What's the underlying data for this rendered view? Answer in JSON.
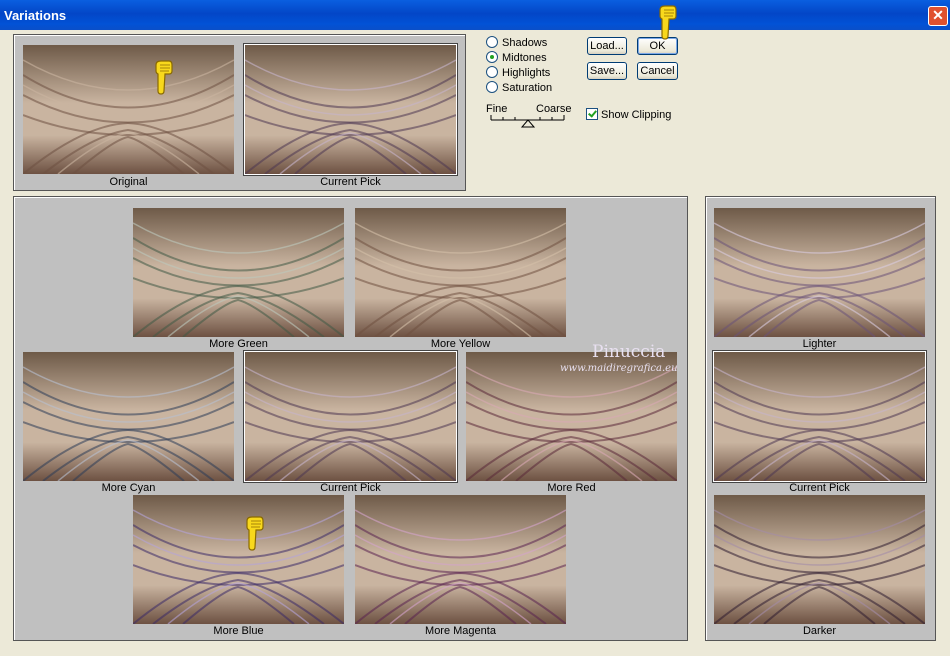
{
  "window": {
    "title": "Variations",
    "close_glyph": "✕"
  },
  "top_thumbs": [
    {
      "label": "Original",
      "tint": "orig"
    },
    {
      "label": "Current Pick",
      "tint": "current"
    }
  ],
  "options": {
    "radios": [
      {
        "label": "Shadows",
        "selected": false
      },
      {
        "label": "Midtones",
        "selected": true
      },
      {
        "label": "Highlights",
        "selected": false
      },
      {
        "label": "Saturation",
        "selected": false
      }
    ],
    "slider": {
      "fine_label": "Fine",
      "coarse_label": "Coarse"
    },
    "buttons": {
      "load": "Load...",
      "ok": "OK",
      "save": "Save...",
      "cancel": "Cancel"
    },
    "show_clipping": {
      "label": "Show Clipping",
      "checked": true
    }
  },
  "color_grid": [
    {
      "label": "More Green",
      "tint": "green"
    },
    {
      "label": "More Yellow",
      "tint": "yellow"
    },
    {
      "label": "More Cyan",
      "tint": "cyan"
    },
    {
      "label": "Current Pick",
      "tint": "current"
    },
    {
      "label": "More Red",
      "tint": "red"
    },
    {
      "label": "More Blue",
      "tint": "blue"
    },
    {
      "label": "More Magenta",
      "tint": "magenta"
    }
  ],
  "brightness": [
    {
      "label": "Lighter",
      "tint": "lighter"
    },
    {
      "label": "Current Pick",
      "tint": "current"
    },
    {
      "label": "Darker",
      "tint": "darker"
    }
  ],
  "watermark": {
    "name": "Pinuccia",
    "url": "www.maidiregrafica.eu"
  },
  "tints": {
    "orig": {
      "top": "#6e5a48",
      "mid": "#c9b4a0",
      "bot": "#6d5142"
    },
    "current": {
      "top": "#5a4862",
      "mid": "#c6b4cc",
      "bot": "#4c3652"
    },
    "green": {
      "top": "#4e6654",
      "mid": "#bcc8bc",
      "bot": "#3f5a46"
    },
    "yellow": {
      "top": "#7a6050",
      "mid": "#d4c0a8",
      "bot": "#705040"
    },
    "cyan": {
      "top": "#3c5270",
      "mid": "#b8c0d0",
      "bot": "#2c3c58"
    },
    "red": {
      "top": "#6a3e52",
      "mid": "#d8a8b4",
      "bot": "#5a2838"
    },
    "blue": {
      "top": "#4a3a7c",
      "mid": "#b4a4d8",
      "bot": "#3a2a68"
    },
    "magenta": {
      "top": "#6a3a6c",
      "mid": "#d4a4cc",
      "bot": "#5a2250"
    },
    "lighter": {
      "top": "#76648a",
      "mid": "#d8cce0",
      "bot": "#6a5278"
    },
    "darker": {
      "top": "#3c2c44",
      "mid": "#a48ca8",
      "bot": "#2e1c30"
    }
  }
}
